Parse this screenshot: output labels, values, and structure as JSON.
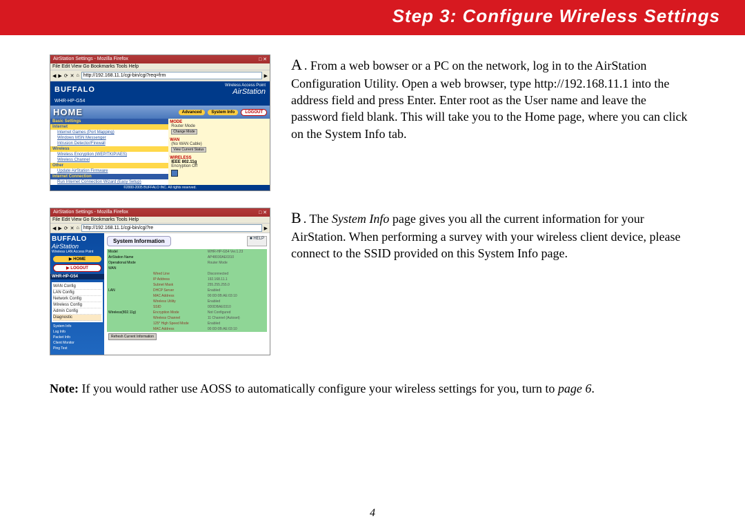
{
  "header": {
    "title": "Step 3:  Configure Wireless Settings"
  },
  "stepA": {
    "letter": "A",
    "text": ". From a web bowser or a PC on the network, log in to the AirStation Configuration Utility.  Open a web browser, type http://192.168.11.1 into the address field and press Enter.  Enter root as the User name and leave the password field blank. This will take you to the Home page, where you can click on the System Info tab."
  },
  "stepB": {
    "letter": "B",
    "pre": ". The ",
    "italic": "System Info",
    "post": " page gives you all the current information for your AirStation.  When performing a survey with your wireless client device, please connect to the SSID provided on this System Info page."
  },
  "note": {
    "label": "Note:",
    "text": "  If you would rather use AOSS to automatically configure your wireless settings for you, turn to ",
    "page_ref": "page 6",
    "end": "."
  },
  "page_number": "4",
  "shotA": {
    "window_title": "AirStation Settings - Mozilla Firefox",
    "menu": "File  Edit  View  Go  Bookmarks  Tools  Help",
    "url": "http://192.168.11.1/cgi-bin/cgi?req=frm",
    "brand": "BUFFALO",
    "air": "AirStation",
    "air_sub": "Wireless Access Point",
    "model": "WHR-HP-G54",
    "home": "HOME",
    "btn_adv": "Advanced",
    "btn_sys": "System Info",
    "btn_logout": "LOGOUT",
    "sec_basic": "Basic Settings",
    "sec_internet": "Internet",
    "i1": "Internet Games (Port Mapping)",
    "i2": "Windows MSN Messenger",
    "i3": "Intrusion Detector/Firewall",
    "sec_wireless": "Wireless",
    "w1": "Wireless Encryption (WEP/TKIP/AES)",
    "w2": "Wireless Channel",
    "sec_other": "Other",
    "o1": "Update AirStation Firmware",
    "sec_conn": "Internet Connection",
    "c1": "Run Internet Connection Wizard (Easy Setup)",
    "r_mode": "MODE",
    "r_mode_v": "Router Mode",
    "btn_change": "Change Mode",
    "r_wan": "WAN",
    "r_wan_v": "(No WAN Cable)",
    "btn_view": "View Current Status",
    "r_wl": "WIRELESS",
    "r_wl_v": "IEEE 802.11g",
    "r_enc": "Encryption   Off",
    "footer": "©2000-2005 BUFFALO INC. All rights reserved."
  },
  "shotB": {
    "window_title": "AirStation Settings - Mozilla Firefox",
    "menu": "File  Edit  View  Go  Bookmarks  Tools  Help",
    "url": "http://192.168.11.1/cgi-bin/cgi?re",
    "brand": "BUFFALO",
    "air": "AirStation",
    "air_sub": "Wireless LAN Access Point",
    "btn_home": "HOME",
    "btn_logout": "LOGOUT",
    "model": "WHR-HP-G54",
    "nav": [
      "WAN Config",
      "LAN Config",
      "Network Config",
      "Wireless Config",
      "Admin Config",
      "Diagnostic"
    ],
    "subnav": [
      "System Info",
      "Log Info",
      "Packet Info",
      "Client Monitor",
      "Ping Test"
    ],
    "section": "System Information",
    "help": "HELP",
    "rows": [
      [
        "Model",
        "",
        "WHR-HP-G54 Ver.1.23"
      ],
      [
        "AirStation Name",
        "",
        "AP48030AE0310"
      ],
      [
        "Operational Mode",
        "",
        "Router Mode"
      ],
      [
        "WAN",
        "",
        ""
      ],
      [
        "",
        "Wired Line",
        "Disconnected"
      ],
      [
        "",
        "IP Address",
        "192.168.11.1"
      ],
      [
        "",
        "Subnet Mask",
        "255.255.255.0"
      ],
      [
        "LAN",
        "DHCP Server",
        "Enabled"
      ],
      [
        "",
        "MAC Address",
        "00:0D:0B:AE:03:10"
      ],
      [
        "",
        "Wireless Utility",
        "Enabled"
      ],
      [
        "",
        "SSID",
        "0D0DBAE0310"
      ],
      [
        "Wireless(802.11g)",
        "Encryption Mode",
        "Not Configured"
      ],
      [
        "",
        "Wireless Channel",
        "11 Channel (Autoset)"
      ],
      [
        "",
        "125* High Speed Mode",
        "Enabled"
      ],
      [
        "",
        "MAC Address",
        "00:0D:0B:AE:03:10"
      ]
    ],
    "refresh": "Refresh Current Information"
  }
}
